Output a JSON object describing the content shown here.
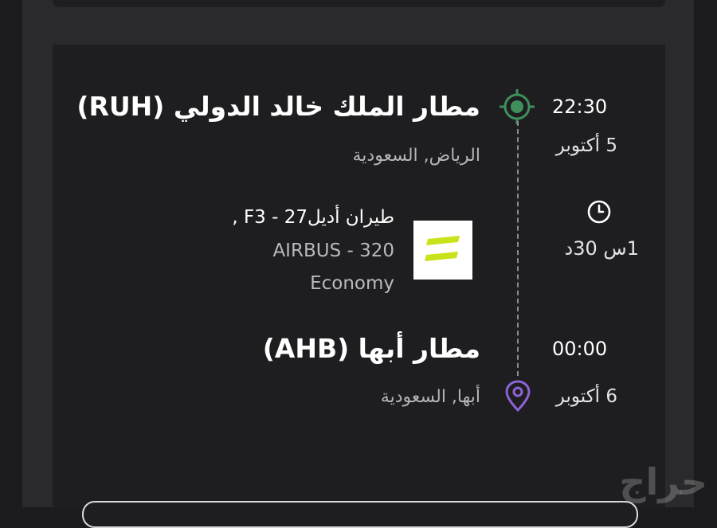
{
  "departure": {
    "airport": "مطار الملك خالد الدولي (RUH)",
    "city": "الرياض, السعودية",
    "time": "22:30",
    "date": "5 أكتوبر"
  },
  "flight": {
    "airline_line": "طيران أديل27 - F3 ,",
    "aircraft": "AIRBUS - 320",
    "cabin": "Economy",
    "duration": "1س 30د",
    "logo_color": "#c9e21a"
  },
  "arrival": {
    "airport": "مطار أبها (AHB)",
    "city": "أبها, السعودية",
    "time": "00:00",
    "date": "6 أكتوبر"
  },
  "watermark": "حراج",
  "colors": {
    "origin_marker": "#3f8f5a",
    "destination_marker": "#8e63d6"
  }
}
